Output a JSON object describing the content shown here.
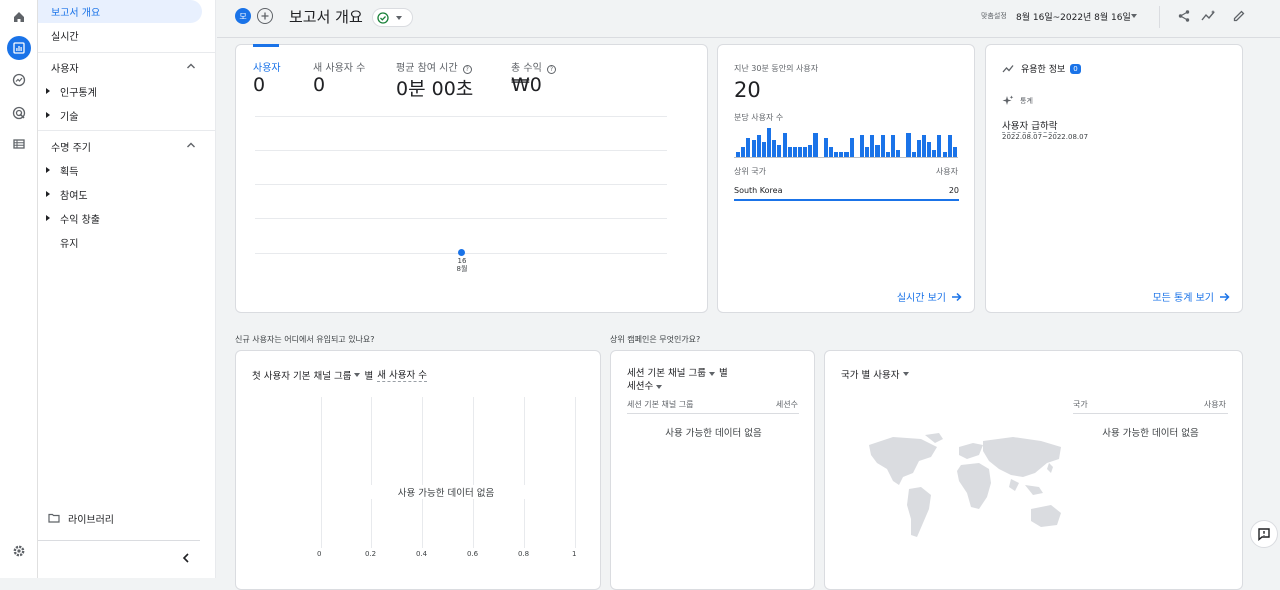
{
  "nav": {
    "items": [
      {
        "icon": "home-icon"
      },
      {
        "icon": "reports-icon"
      },
      {
        "icon": "explore-icon"
      },
      {
        "icon": "advertising-icon"
      },
      {
        "icon": "configure-icon"
      }
    ]
  },
  "sidebar": {
    "active": "보고서 개요",
    "realtime": "실시간",
    "users_section": "사용자",
    "demographics": "인구통계",
    "tech": "기술",
    "lifecycle_section": "수명 주기",
    "acquisition": "획득",
    "engagement": "참여도",
    "monetization": "수익 창출",
    "retention": "유지",
    "library": "라이브러리"
  },
  "header": {
    "avatar_letter": "모",
    "title": "보고서 개요",
    "date_label": "맞춤설정",
    "date_range": "8월 16일~2022년 8월 16일"
  },
  "metrics": {
    "users_label": "사용자",
    "users_value": "0",
    "new_users_label": "새 사용자 수",
    "new_users_value": "0",
    "engagement_label": "평균 참여 시간",
    "engagement_value": "0분 00초",
    "revenue_label": "총 수익",
    "revenue_value": "₩0",
    "point_day": "16",
    "point_month": "8월"
  },
  "realtime": {
    "title": "지난 30분 동안의 사용자",
    "value": "20",
    "per_minute": "분당 사용자 수",
    "col_country": "상위 국가",
    "col_users": "사용자",
    "row_country": "South Korea",
    "row_value": "20",
    "link": "실시간 보기"
  },
  "realtime_bars": [
    2,
    4,
    8,
    7,
    9,
    6,
    12,
    7,
    5,
    10,
    4,
    4,
    4,
    4,
    5,
    10,
    0,
    8,
    4,
    2,
    2,
    2,
    8,
    0,
    9,
    4,
    9,
    5,
    9,
    2,
    9,
    3,
    0,
    10,
    2,
    7,
    9,
    6,
    3,
    9,
    2,
    9,
    4
  ],
  "insights": {
    "title": "유용한 정보",
    "badge": "0",
    "tag": "통계",
    "headline": "사용자 급하락",
    "date": "2022.08.07~2022.08.07",
    "link": "모든 통계 보기"
  },
  "section1_title": "신규 사용자는 어디에서 유입되고 있나요?",
  "section2_title": "상위 캠페인은 무엇인가요?",
  "channels": {
    "dimension": "첫 사용자 기본 채널 그룹",
    "by": "별",
    "metric": "새 사용자 수",
    "empty": "사용 가능한 데이터 없음",
    "ticks": [
      "0",
      "0.2",
      "0.4",
      "0.6",
      "0.8",
      "1"
    ]
  },
  "campaigns": {
    "dimension": "세션 기본 채널 그룹",
    "by": "별",
    "metric": "세션수",
    "col1": "세션 기본 채널 그룹",
    "col2": "세션수",
    "empty": "사용 가능한 데이터 없음"
  },
  "country": {
    "title": "국가 별 사용자",
    "col1": "국가",
    "col2": "사용자",
    "empty": "사용 가능한 데이터 없음"
  },
  "colors": {
    "accent": "#1a73e8",
    "success": "#188038"
  }
}
